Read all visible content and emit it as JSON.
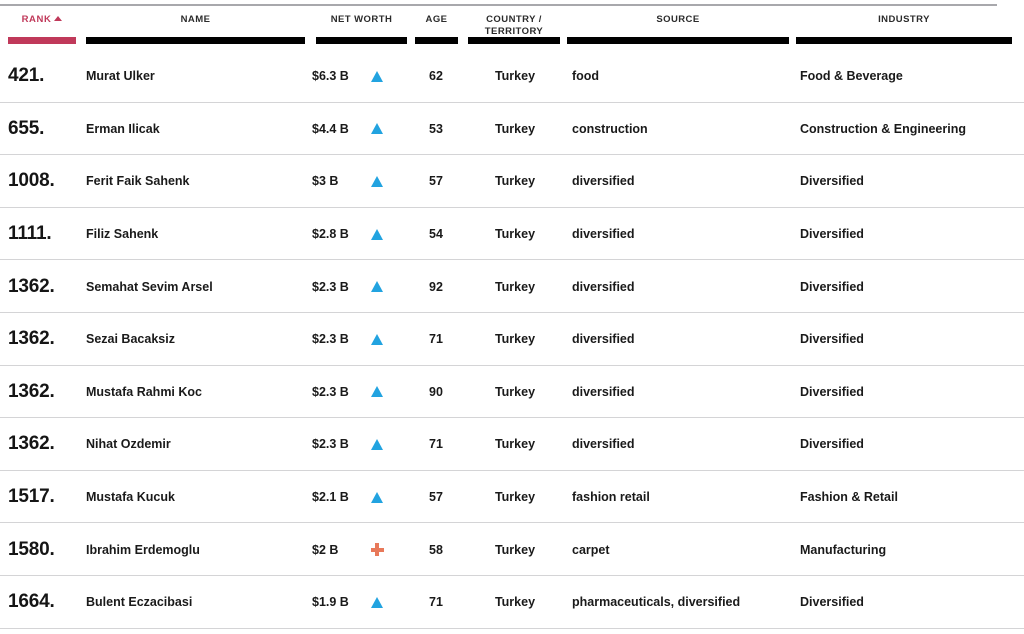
{
  "table": {
    "columns": [
      {
        "key": "rank",
        "label": "RANK",
        "sort": "ascending",
        "sort_icon": "chevron-up-icon",
        "accent": "#c0395a"
      },
      {
        "key": "name",
        "label": "NAME",
        "sort": "none"
      },
      {
        "key": "net_worth",
        "label": "NET WORTH",
        "sort": "none"
      },
      {
        "key": "age",
        "label": "AGE",
        "sort": "none"
      },
      {
        "key": "country",
        "label": "COUNTRY /\nTERRITORY",
        "sort": "none"
      },
      {
        "key": "source",
        "label": "SOURCE",
        "sort": "none"
      },
      {
        "key": "industry",
        "label": "INDUSTRY",
        "sort": "none"
      }
    ],
    "rows": [
      {
        "rank": "421.",
        "name": "Murat Ulker",
        "net_worth": "$6.3 B",
        "change_icon": "triangle-up-icon",
        "change_color": "#22a3e0",
        "age": "62",
        "country": "Turkey",
        "source": "food",
        "industry": "Food & Beverage"
      },
      {
        "rank": "655.",
        "name": "Erman Ilicak",
        "net_worth": "$4.4 B",
        "change_icon": "triangle-up-icon",
        "change_color": "#22a3e0",
        "age": "53",
        "country": "Turkey",
        "source": "construction",
        "industry": "Construction & Engineering"
      },
      {
        "rank": "1008.",
        "name": "Ferit Faik Sahenk",
        "net_worth": "$3 B",
        "change_icon": "triangle-up-icon",
        "change_color": "#22a3e0",
        "age": "57",
        "country": "Turkey",
        "source": "diversified",
        "industry": "Diversified"
      },
      {
        "rank": "1111.",
        "name": "Filiz Sahenk",
        "net_worth": "$2.8 B",
        "change_icon": "triangle-up-icon",
        "change_color": "#22a3e0",
        "age": "54",
        "country": "Turkey",
        "source": "diversified",
        "industry": "Diversified"
      },
      {
        "rank": "1362.",
        "name": "Semahat Sevim Arsel",
        "net_worth": "$2.3 B",
        "change_icon": "triangle-up-icon",
        "change_color": "#22a3e0",
        "age": "92",
        "country": "Turkey",
        "source": "diversified",
        "industry": "Diversified"
      },
      {
        "rank": "1362.",
        "name": "Sezai Bacaksiz",
        "net_worth": "$2.3 B",
        "change_icon": "triangle-up-icon",
        "change_color": "#22a3e0",
        "age": "71",
        "country": "Turkey",
        "source": "diversified",
        "industry": "Diversified"
      },
      {
        "rank": "1362.",
        "name": "Mustafa Rahmi Koc",
        "net_worth": "$2.3 B",
        "change_icon": "triangle-up-icon",
        "change_color": "#22a3e0",
        "age": "90",
        "country": "Turkey",
        "source": "diversified",
        "industry": "Diversified"
      },
      {
        "rank": "1362.",
        "name": "Nihat Ozdemir",
        "net_worth": "$2.3 B",
        "change_icon": "triangle-up-icon",
        "change_color": "#22a3e0",
        "age": "71",
        "country": "Turkey",
        "source": "diversified",
        "industry": "Diversified"
      },
      {
        "rank": "1517.",
        "name": "Mustafa Kucuk",
        "net_worth": "$2.1 B",
        "change_icon": "triangle-up-icon",
        "change_color": "#22a3e0",
        "age": "57",
        "country": "Turkey",
        "source": "fashion retail",
        "industry": "Fashion & Retail"
      },
      {
        "rank": "1580.",
        "name": "Ibrahim Erdemoglu",
        "net_worth": "$2 B",
        "change_icon": "plus-icon",
        "change_color": "#e8795a",
        "age": "58",
        "country": "Turkey",
        "source": "carpet",
        "industry": "Manufacturing"
      },
      {
        "rank": "1664.",
        "name": "Bulent Eczacibasi",
        "net_worth": "$1.9 B",
        "change_icon": "triangle-up-icon",
        "change_color": "#22a3e0",
        "age": "71",
        "country": "Turkey",
        "source": "pharmaceuticals, diversified",
        "industry": "Diversified"
      }
    ]
  }
}
